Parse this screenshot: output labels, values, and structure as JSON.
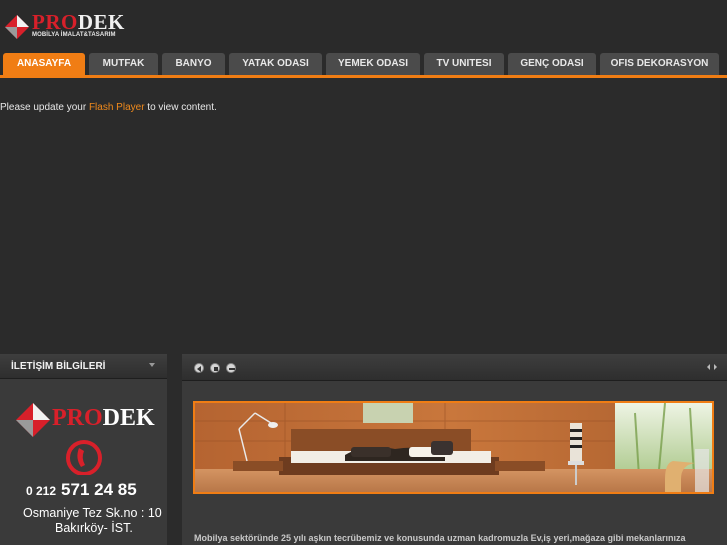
{
  "header": {
    "logo_pro": "PRO",
    "logo_dek": "DEK",
    "logo_subtitle": "MOBİLYA İMALAT&TASARIM"
  },
  "nav": {
    "tabs": [
      {
        "label": "ANASAYFA",
        "active": true
      },
      {
        "label": "MUTFAK",
        "active": false
      },
      {
        "label": "BANYO",
        "active": false
      },
      {
        "label": "YATAK ODASI",
        "active": false
      },
      {
        "label": "YEMEK ODASI",
        "active": false
      },
      {
        "label": "TV UNITESI",
        "active": false
      },
      {
        "label": "GENÇ ODASI",
        "active": false
      },
      {
        "label": "OFIS DEKORASYON",
        "active": false
      }
    ],
    "accent_color": "#f07d14"
  },
  "flash": {
    "msg_before": "Please update your ",
    "link": "Flash Player",
    "msg_after": " to view content."
  },
  "sidebar": {
    "title": "İLETİŞİM BİLGİLERİ",
    "brand_pro": "PRO",
    "brand_dek": "DEK",
    "phone_prefix": "0 212",
    "phone_number": "571 24 85",
    "address_line1": "Osmaniye Tez Sk.no : 10",
    "address_line2": "Bakırköy- İST."
  },
  "main": {
    "controls": [
      "prev-icon",
      "stop-icon",
      "minus-icon"
    ],
    "description": "Mobilya sektöründe 25 yılı aşkın tecrübemiz ve konusunda uzman kadromuzla Ev,iş yeri,mağaza gibi mekanlarınıza"
  }
}
